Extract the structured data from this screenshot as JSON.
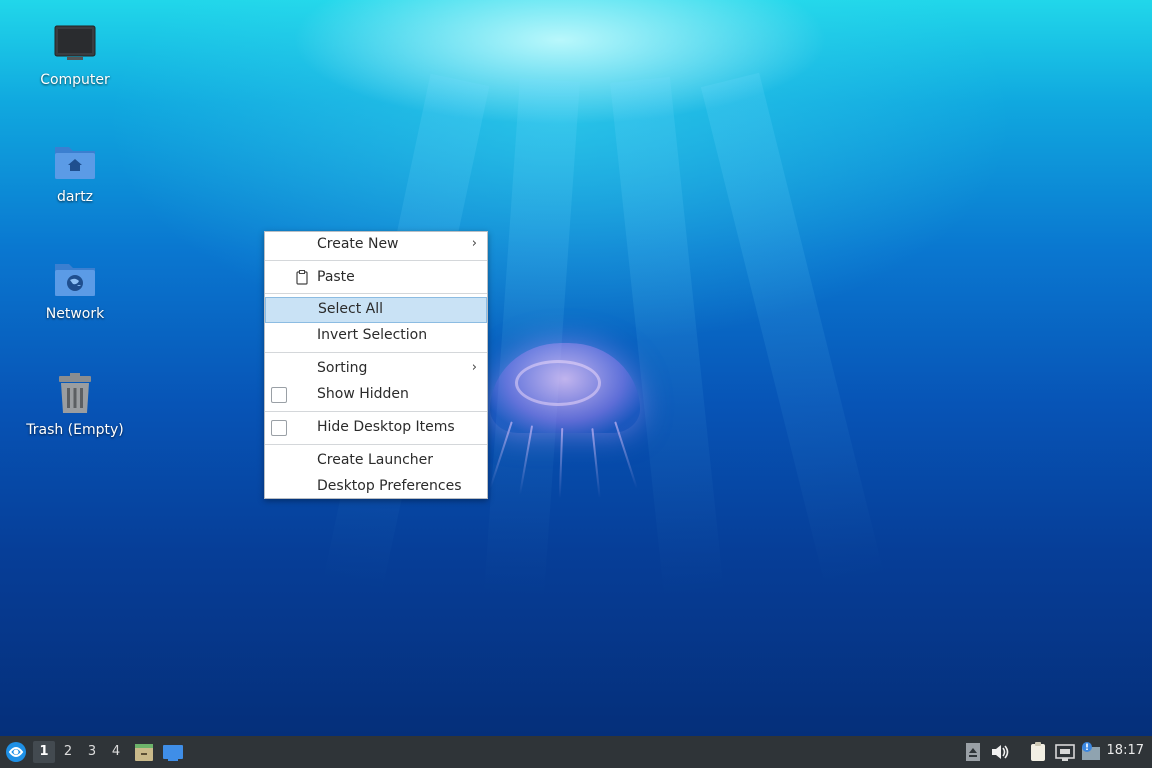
{
  "desktop": {
    "icons": [
      {
        "label": "Computer",
        "icon": "computer-icon"
      },
      {
        "label": "dartz",
        "icon": "home-folder-icon"
      },
      {
        "label": "Network",
        "icon": "network-folder-icon"
      },
      {
        "label": "Trash (Empty)",
        "icon": "trash-icon"
      }
    ]
  },
  "context_menu": {
    "items": [
      {
        "label": "Create New",
        "submenu": true
      },
      {
        "label": "Paste",
        "icon": "clipboard-icon"
      },
      {
        "label": "Select All",
        "highlighted": true
      },
      {
        "label": "Invert Selection"
      },
      {
        "label": "Sorting",
        "submenu": true
      },
      {
        "label": "Show Hidden",
        "checkbox": true,
        "checked": false
      },
      {
        "label": "Hide Desktop Items",
        "checkbox": true,
        "checked": false
      },
      {
        "label": "Create Launcher"
      },
      {
        "label": "Desktop Preferences"
      }
    ],
    "submenu_glyph": "›"
  },
  "panel": {
    "workspaces": [
      "1",
      "2",
      "3",
      "4"
    ],
    "active_workspace": "1",
    "clock": "18:17",
    "accent": "#2f3438"
  }
}
